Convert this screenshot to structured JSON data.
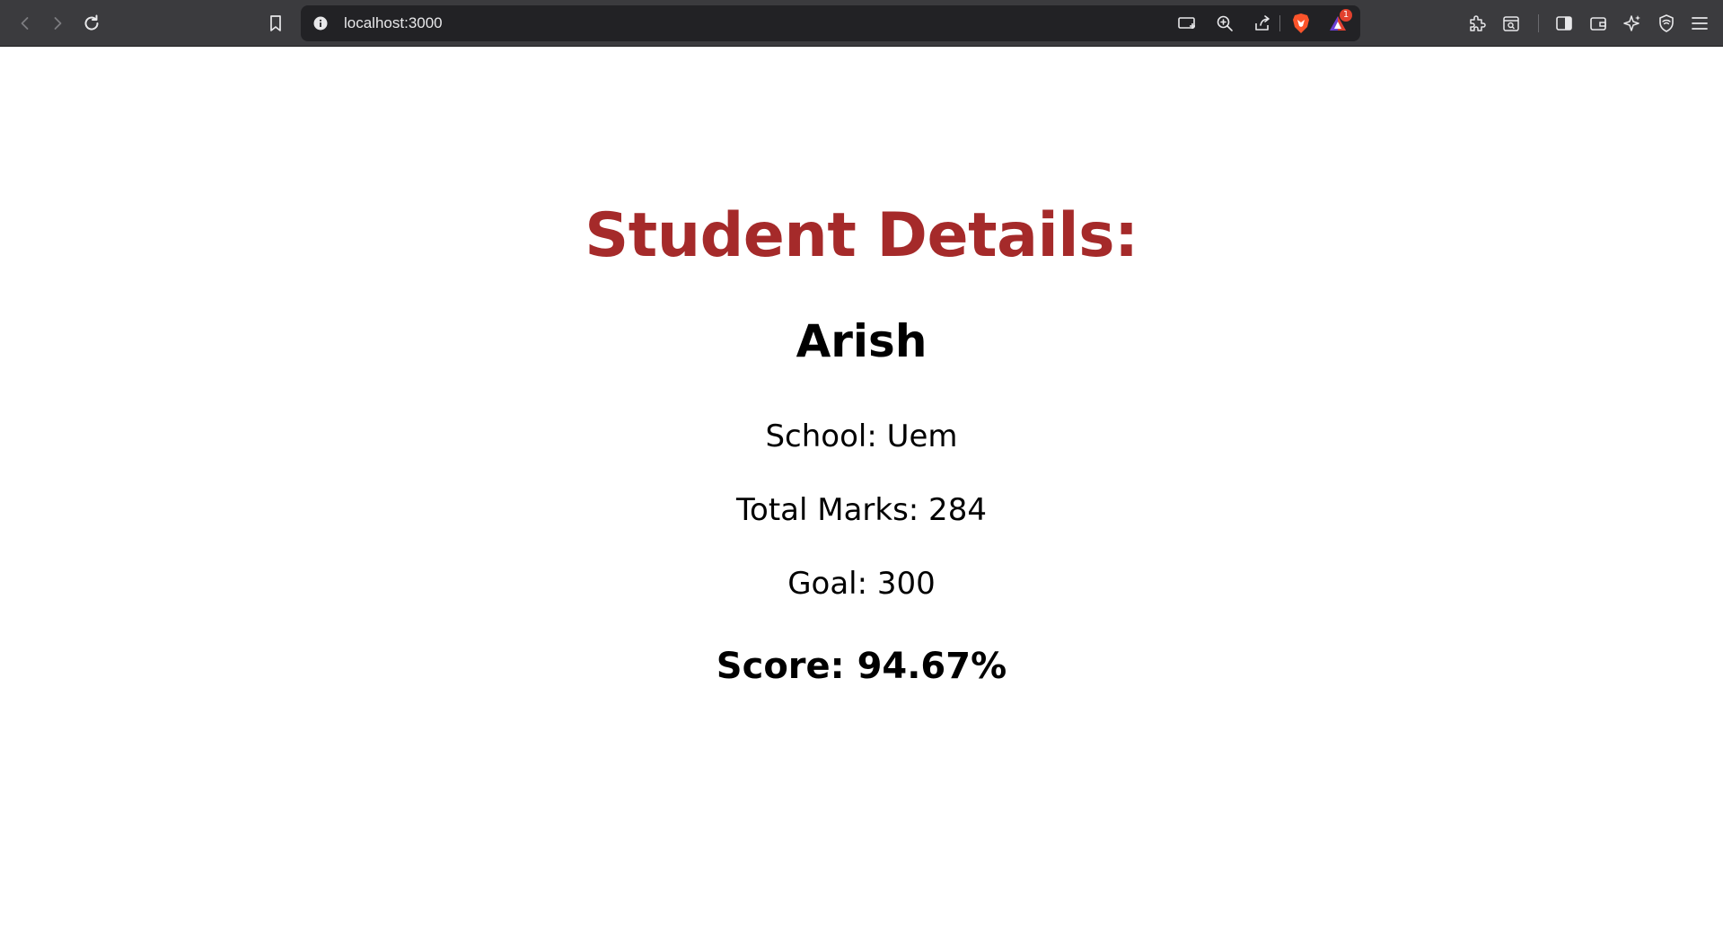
{
  "browser": {
    "url": "localhost:3000",
    "notification_count": "1"
  },
  "page": {
    "heading": "Student Details:",
    "student_name": "Arish",
    "school_line": "School: Uem",
    "total_marks_line": "Total Marks: 284",
    "goal_line": "Goal: 300",
    "score_line": "Score: 94.67%"
  },
  "colors": {
    "heading": "#a52a2a",
    "chrome": "#3b3b3e",
    "urlbar": "#222225"
  }
}
